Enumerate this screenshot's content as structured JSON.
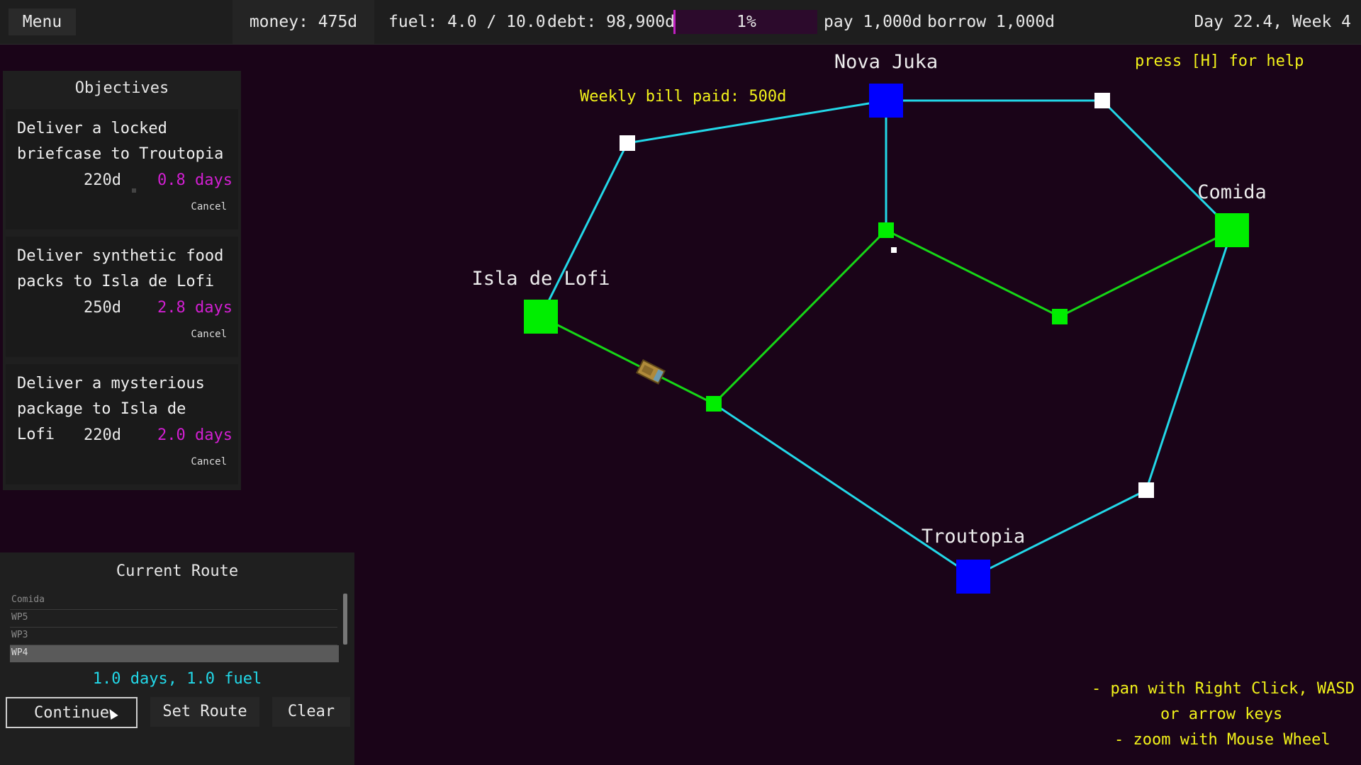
{
  "topbar": {
    "menu_label": "Menu",
    "money": "money: 475d",
    "fuel": "fuel: 4.0 / 10.0",
    "debt": "debt: 98,900d",
    "debt_percent": "1%",
    "debt_progress": 0.01,
    "pay": "pay 1,000d",
    "borrow": "borrow 1,000d",
    "day": "Day 22.4, Week 4"
  },
  "map": {
    "notification": "Weekly bill paid: 500d",
    "help_hint": "press [H] for help",
    "controls": [
      "- pan with Right Click, WASD",
      "or arrow keys",
      "- zoom with Mouse Wheel"
    ],
    "cities": {
      "nova_juka": "Nova Juka",
      "comida": "Comida",
      "isla_de_lofi": "Isla de Lofi",
      "troutopia": "Troutopia"
    },
    "colors": {
      "background": "#1a0418",
      "cyan_route": "#22d8e8",
      "green_route": "#16d616",
      "blue_city": "#0000ff",
      "green_node": "#00ee00",
      "white_node": "#ffffff"
    }
  },
  "objectives": {
    "title": "Objectives",
    "items": [
      {
        "desc": "Deliver a locked briefcase to Troutopia",
        "pay": "220d",
        "days": "0.8 days",
        "cancel": "Cancel"
      },
      {
        "desc": "Deliver synthetic food packs to Isla de Lofi",
        "pay": "250d",
        "days": "2.8 days",
        "cancel": "Cancel"
      },
      {
        "desc": "Deliver a mysterious package to Isla de Lofi",
        "pay": "220d",
        "days": "2.0 days",
        "cancel": "Cancel"
      }
    ]
  },
  "route": {
    "title": "Current Route",
    "items": [
      "Comida",
      "WP5",
      "WP3",
      "WP4"
    ],
    "selected_index": 3,
    "info": "1.0 days, 1.0 fuel",
    "continue_label": "Continue",
    "set_route_label": "Set Route",
    "clear_label": "Clear"
  }
}
